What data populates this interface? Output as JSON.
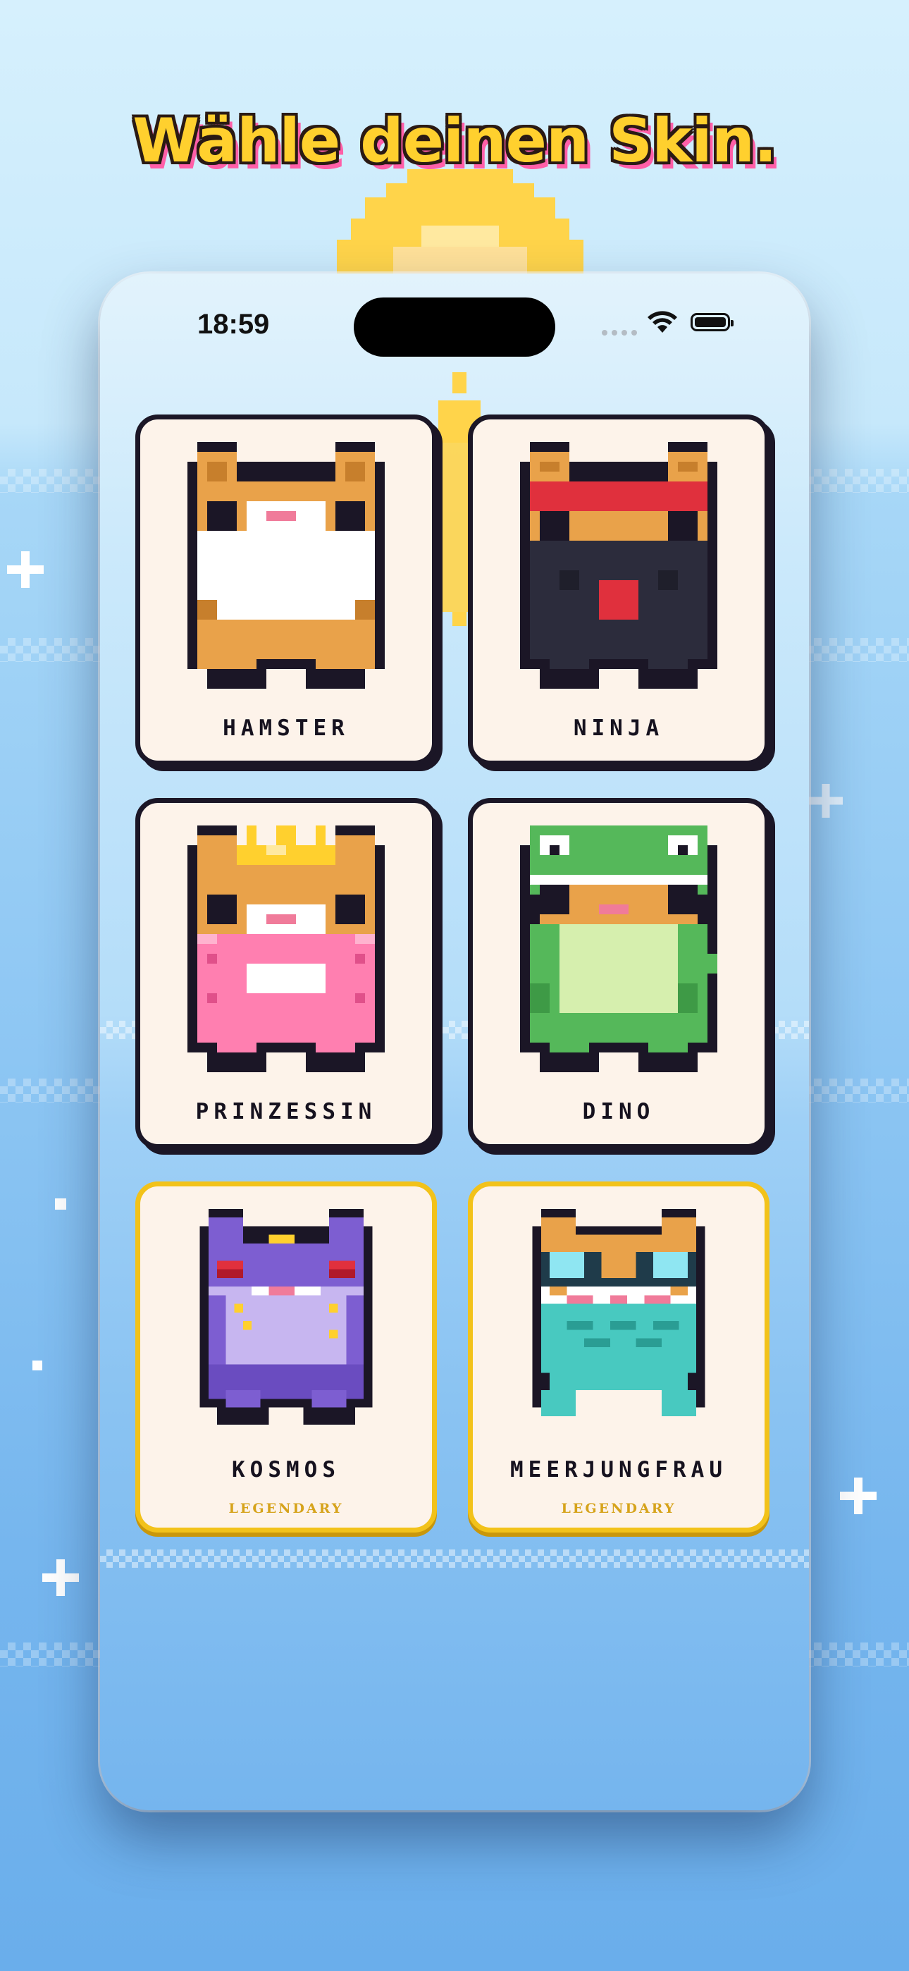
{
  "headline": "Wähle deinen Skin.",
  "status_bar": {
    "time": "18:59",
    "icons": [
      "wifi-icon",
      "battery-icon"
    ]
  },
  "skins": [
    {
      "name": "HAMSTER",
      "rarity": "",
      "selected": false
    },
    {
      "name": "NINJA",
      "rarity": "",
      "selected": false
    },
    {
      "name": "PRINZESSIN",
      "rarity": "",
      "selected": false
    },
    {
      "name": "DINO",
      "rarity": "",
      "selected": false
    },
    {
      "name": "KOSMOS",
      "rarity": "LEGENDARY",
      "selected": false
    },
    {
      "name": "MEERJUNGFRAU",
      "rarity": "LEGENDARY",
      "selected": false
    }
  ],
  "colors": {
    "headline_fill": "#ffd02e",
    "headline_shadow": "#ff5fa8",
    "card_background": "#fdf3ea",
    "card_border": "#1b1626",
    "legendary_border": "#f2c21a",
    "legendary_text": "#d6a31b"
  }
}
